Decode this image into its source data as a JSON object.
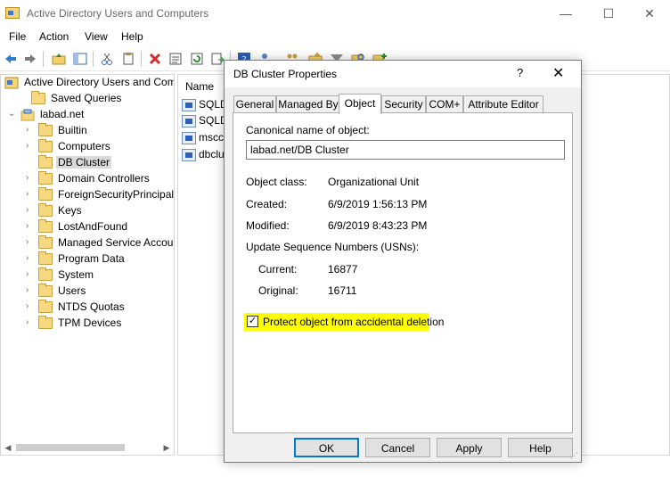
{
  "app": {
    "title": "Active Directory Users and Computers",
    "window_controls": {
      "minimize": "—",
      "maximize": "☐",
      "close": "✕"
    }
  },
  "menu": [
    "File",
    "Action",
    "View",
    "Help"
  ],
  "toolbar_icons": [
    "back-arrow-icon",
    "forward-arrow-icon",
    "up-folder-icon",
    "show-hide-tree-icon",
    "cut-icon",
    "copy-icon",
    "delete-icon",
    "properties-icon",
    "refresh-icon",
    "export-list-icon",
    "help-icon",
    "add-user-icon",
    "add-group-icon",
    "add-ou-icon",
    "filter-icon",
    "find-icon",
    "add-to-group-icon"
  ],
  "tree": {
    "root": "Active Directory Users and Com",
    "items": [
      {
        "label": "Saved Queries",
        "expander": "",
        "indent": 1
      },
      {
        "label": "labad.net",
        "expander": "⌄",
        "indent": 0
      },
      {
        "label": "Builtin",
        "expander": "›",
        "indent": 2
      },
      {
        "label": "Computers",
        "expander": "›",
        "indent": 2
      },
      {
        "label": "DB Cluster",
        "expander": "",
        "indent": 2,
        "selected": true
      },
      {
        "label": "Domain Controllers",
        "expander": "›",
        "indent": 2
      },
      {
        "label": "ForeignSecurityPrincipals",
        "expander": "›",
        "indent": 2
      },
      {
        "label": "Keys",
        "expander": "›",
        "indent": 2
      },
      {
        "label": "LostAndFound",
        "expander": "›",
        "indent": 2
      },
      {
        "label": "Managed Service Accour",
        "expander": "›",
        "indent": 2
      },
      {
        "label": "Program Data",
        "expander": "›",
        "indent": 2
      },
      {
        "label": "System",
        "expander": "›",
        "indent": 2
      },
      {
        "label": "Users",
        "expander": "›",
        "indent": 2
      },
      {
        "label": "NTDS Quotas",
        "expander": "›",
        "indent": 2
      },
      {
        "label": "TPM Devices",
        "expander": "›",
        "indent": 2
      }
    ],
    "scroll_left": "◀",
    "scroll_right": "▶"
  },
  "list": {
    "column_header": "Name",
    "rows": [
      "SQLD",
      "SQLD",
      "mscc",
      "dbclu"
    ]
  },
  "dialog": {
    "title": "DB Cluster Properties",
    "help": "?",
    "close": "✕",
    "tabs": [
      "General",
      "Managed By",
      "Object",
      "Security",
      "COM+",
      "Attribute Editor"
    ],
    "active_tab": "Object",
    "canonical_label": "Canonical name of object:",
    "canonical_value": "labad.net/DB Cluster",
    "object_class_label": "Object class:",
    "object_class_value": "Organizational Unit",
    "created_label": "Created:",
    "created_value": "6/9/2019 1:56:13 PM",
    "modified_label": "Modified:",
    "modified_value": "6/9/2019 8:43:23 PM",
    "usn_label": "Update Sequence Numbers (USNs):",
    "current_label": "Current:",
    "current_value": "16877",
    "original_label": "Original:",
    "original_value": "16711",
    "protect_label": "Protect object from accidental deletion",
    "protect_checked": true,
    "check_mark": "✓",
    "highlight_color": "#ffff00",
    "buttons": {
      "ok": "OK",
      "cancel": "Cancel",
      "apply": "Apply",
      "help": "Help"
    }
  },
  "accent_color": "#0078d7"
}
